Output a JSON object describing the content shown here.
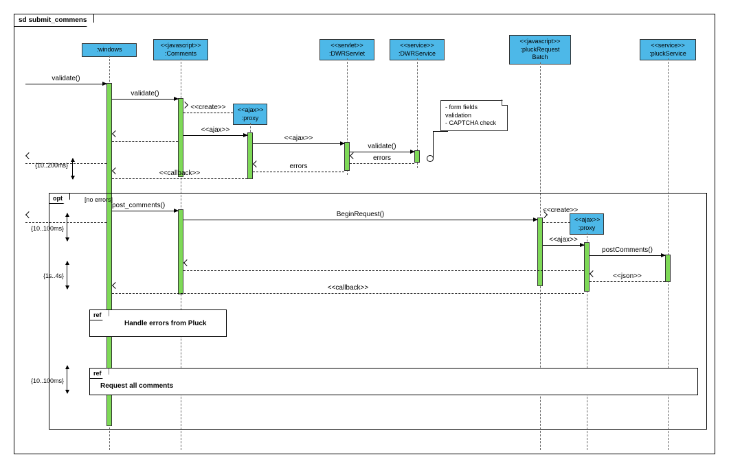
{
  "diagram_title": "sd submit_commens",
  "lifelines": {
    "windows": {
      "name": ":windows"
    },
    "comments": {
      "stereotype": "<<javascript>>",
      "name": ":Comments"
    },
    "proxy1": {
      "stereotype": "<<ajax>>",
      "name": ":proxy"
    },
    "dwrservlet": {
      "stereotype": "<<servlet>>",
      "name": ":DWRServlet"
    },
    "dwrservice": {
      "stereotype": "<<service>>",
      "name": ":DWRService"
    },
    "pluckreq": {
      "stereotype": "<<javascript>>",
      "name": ":pluckRequest Batch"
    },
    "proxy2": {
      "stereotype": "<<ajax>>",
      "name": ":proxy"
    },
    "pluckservice": {
      "stereotype": "<<service>>",
      "name": ":pluckService"
    }
  },
  "messages": {
    "m1": "validate()",
    "m2": "validate()",
    "m3": "<<create>>",
    "m4": "<<ajax>>",
    "m5": "<<ajax>>",
    "m6": "validate()",
    "m7": "errors",
    "m8": "errors",
    "m9": "<<callback>>",
    "guard": "[no errors]",
    "m10": "post_comments()",
    "m11": "BeginRequest()",
    "m12": "<<create>>",
    "m13": "<<ajax>>",
    "m14": "postComments()",
    "m15": "<<json>>",
    "m16": "<<callback>>"
  },
  "note": {
    "line1": "- form fields",
    "line2": "validation",
    "line3": "- CAPTCHA check"
  },
  "fragments": {
    "opt": "opt",
    "ref1": "ref",
    "ref1_title": "Handle errors from Pluck",
    "ref2": "ref",
    "ref2_title": "Request all comments"
  },
  "durations": {
    "d1": "{10..200ms}",
    "d2": "{10..100ms}",
    "d3": "{1s..4s}",
    "d4": "{10..100ms}"
  },
  "chart_data": {
    "type": "sequence-diagram",
    "title": "sd submit_commens",
    "participants": [
      {
        "name": ":windows"
      },
      {
        "name": ":Comments",
        "stereotype": "javascript"
      },
      {
        "name": ":proxy",
        "stereotype": "ajax",
        "created_by": ":Comments"
      },
      {
        "name": ":DWRServlet",
        "stereotype": "servlet"
      },
      {
        "name": ":DWRService",
        "stereotype": "service"
      },
      {
        "name": ":pluckRequest Batch",
        "stereotype": "javascript"
      },
      {
        "name": ":proxy",
        "stereotype": "ajax",
        "created_by": ":pluckRequest Batch"
      },
      {
        "name": ":pluckService",
        "stereotype": "service"
      }
    ],
    "interactions": [
      {
        "from": "(external)",
        "to": ":windows",
        "label": "validate()",
        "type": "sync"
      },
      {
        "from": ":windows",
        "to": ":Comments",
        "label": "validate()",
        "type": "sync"
      },
      {
        "from": ":Comments",
        "to": ":proxy#1",
        "label": "<<create>>",
        "type": "create"
      },
      {
        "from": ":Comments",
        "to": ":proxy#1",
        "label": "<<ajax>>",
        "type": "sync"
      },
      {
        "from": ":proxy#1",
        "to": ":DWRServlet",
        "label": "<<ajax>>",
        "type": "sync"
      },
      {
        "from": ":DWRServlet",
        "to": ":DWRService",
        "label": "validate()",
        "type": "sync",
        "note": "- form fields validation - CAPTCHA check"
      },
      {
        "from": ":DWRService",
        "to": ":DWRServlet",
        "label": "errors",
        "type": "return"
      },
      {
        "from": ":DWRServlet",
        "to": ":proxy#1",
        "label": "errors",
        "type": "return"
      },
      {
        "from": ":proxy#1",
        "to": ":windows",
        "label": "<<callback>>",
        "type": "return",
        "duration": "{10..200ms}"
      },
      {
        "from": ":windows",
        "to": "(external)",
        "type": "return"
      },
      {
        "fragment": "opt",
        "guard": "[no errors]",
        "contents": [
          {
            "from": ":windows",
            "to": ":Comments",
            "label": "post_comments()",
            "type": "sync"
          },
          {
            "from": ":windows",
            "to": "(external)",
            "type": "return",
            "duration": "{10..100ms}"
          },
          {
            "from": ":Comments",
            "to": ":pluckRequest Batch",
            "label": "BeginRequest()",
            "type": "sync"
          },
          {
            "from": ":pluckRequest Batch",
            "to": ":proxy#2",
            "label": "<<create>>",
            "type": "create"
          },
          {
            "from": ":pluckRequest Batch",
            "to": ":proxy#2",
            "label": "<<ajax>>",
            "type": "sync"
          },
          {
            "from": ":proxy#2",
            "to": ":pluckService",
            "label": "postComments()",
            "type": "sync"
          },
          {
            "from": ":pluckService",
            "to": ":proxy#2",
            "label": "<<json>>",
            "type": "return"
          },
          {
            "from": ":proxy#2",
            "to": ":Comments",
            "type": "return"
          },
          {
            "from": ":proxy#2",
            "to": ":windows",
            "label": "<<callback>>",
            "type": "return",
            "duration": "{1s..4s}"
          },
          {
            "fragment": "ref",
            "label": "Handle errors from Pluck"
          },
          {
            "fragment": "ref",
            "label": "Request all comments",
            "duration": "{10..100ms}"
          }
        ]
      }
    ]
  }
}
